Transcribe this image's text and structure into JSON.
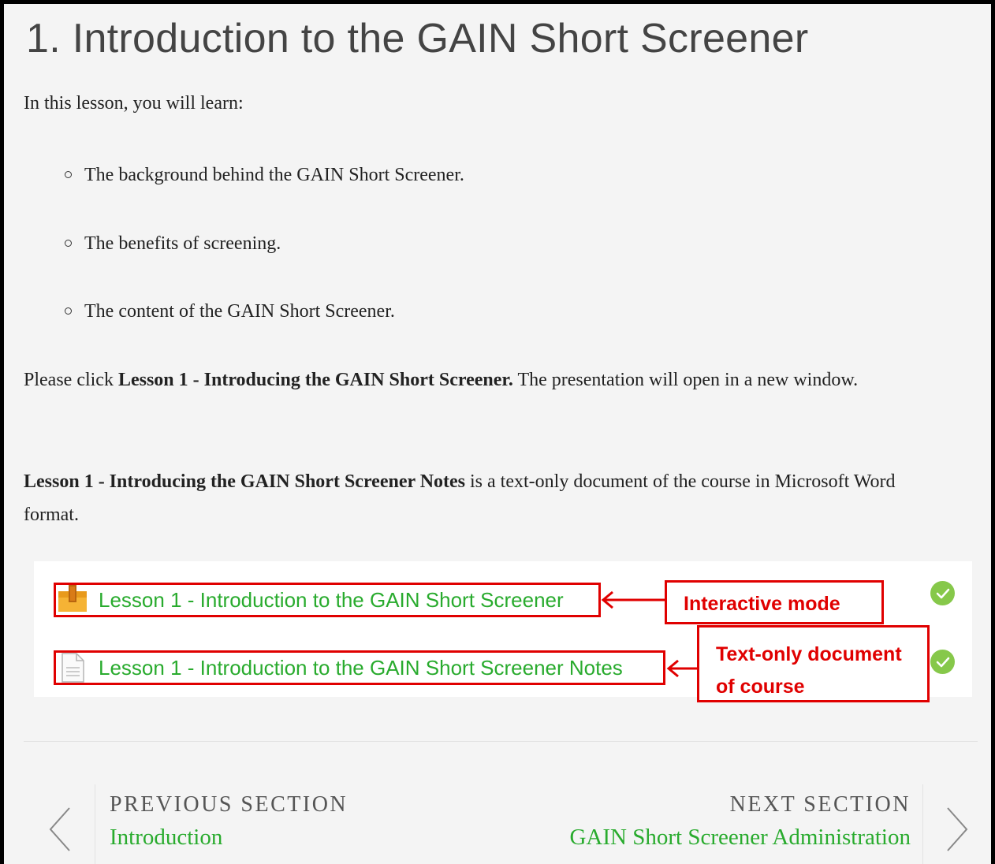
{
  "title": "1. Introduction to the GAIN Short Screener",
  "intro": "In this lesson, you will learn:",
  "learning_points": [
    "The background behind the GAIN Short Screener.",
    "The benefits of screening.",
    "The content of the GAIN Short Screener."
  ],
  "instruction": {
    "prefix": "Please click ",
    "bold": "Lesson 1 - Introducing the GAIN Short Screener.",
    "suffix": " The presentation will open in a new window."
  },
  "notes_info": {
    "bold": "Lesson 1 - Introducing the GAIN Short Screener Notes",
    "suffix": " is a text-only document of the course in Microsoft Word format."
  },
  "activities": [
    {
      "label": "Lesson 1 - Introduction to the GAIN Short Screener",
      "icon": "package-icon",
      "completed": true
    },
    {
      "label": "Lesson 1 - Introduction to the GAIN Short Screener Notes",
      "icon": "document-icon",
      "completed": true
    }
  ],
  "callouts": {
    "interactive": "Interactive mode",
    "text_only_line1": "Text-only document",
    "text_only_line2": "of course"
  },
  "navigation": {
    "previous_heading": "PREVIOUS SECTION",
    "previous_link": "Introduction",
    "next_heading": "NEXT SECTION",
    "next_link": "GAIN Short Screener Administration"
  },
  "colors": {
    "link_green": "#29ab2e",
    "annotation_red": "#e00000",
    "check_green": "#86c84a",
    "page_background": "#f4f4f4"
  }
}
